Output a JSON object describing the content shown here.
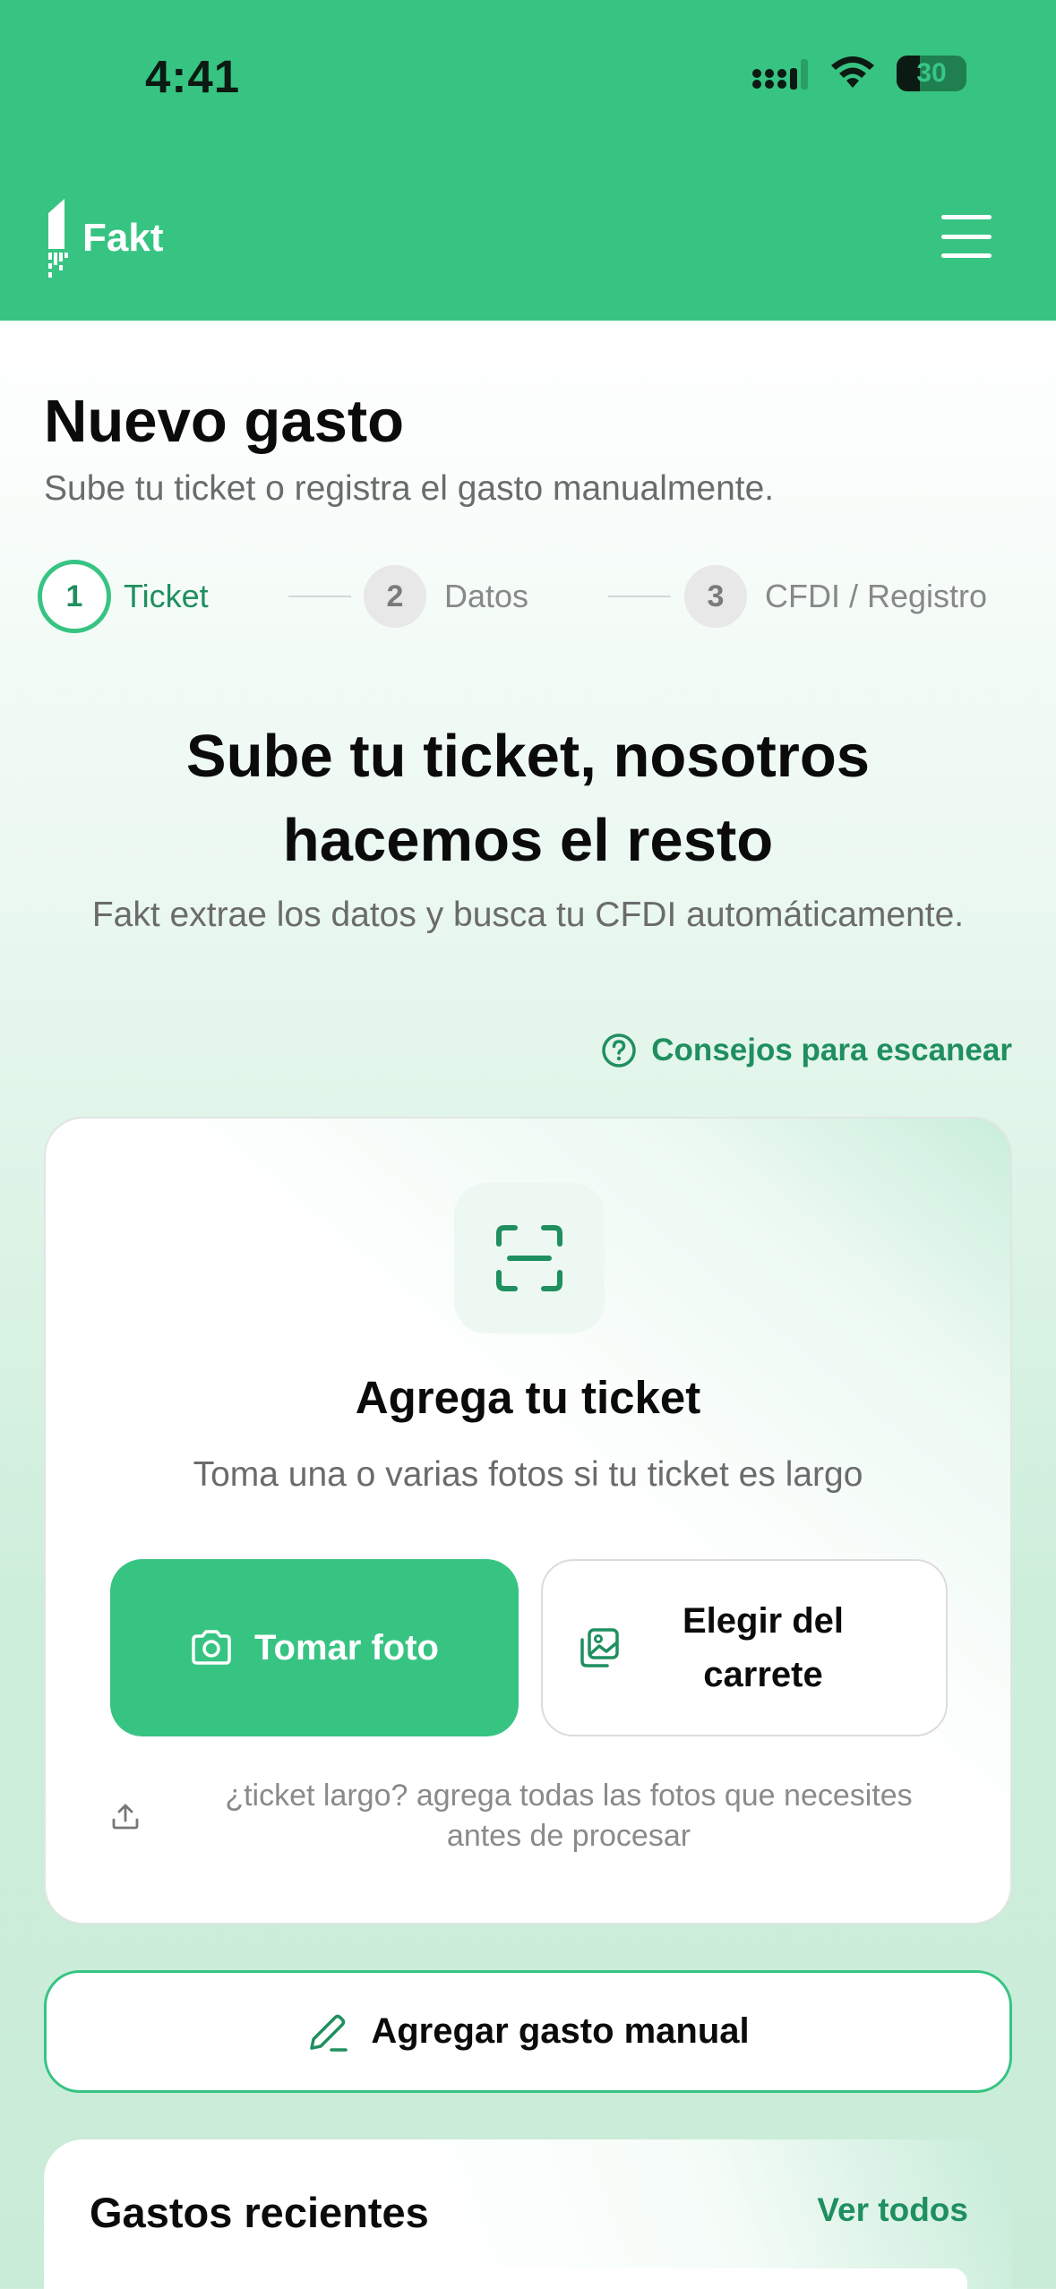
{
  "status_bar": {
    "time": "4:41",
    "battery": "30"
  },
  "header": {
    "brand": "Fakt"
  },
  "page": {
    "title": "Nuevo gasto",
    "subtitle": "Sube tu ticket o registra el gasto manualmente."
  },
  "stepper": {
    "steps": [
      {
        "number": "1",
        "label": "Ticket",
        "active": true
      },
      {
        "number": "2",
        "label": "Datos",
        "active": false
      },
      {
        "number": "3",
        "label": "CFDI / Registro",
        "active": false
      }
    ]
  },
  "hero": {
    "title_line1": "Sube tu ticket, nosotros",
    "title_line2": "hacemos el resto",
    "subtitle": "Fakt extrae los datos y busca tu CFDI automáticamente."
  },
  "tips": {
    "label": "Consejos para escanear"
  },
  "upload": {
    "title": "Agrega tu ticket",
    "subtitle": "Toma una o varias fotos si tu ticket es largo",
    "take_photo": "Tomar foto",
    "choose_roll_line1": "Elegir del",
    "choose_roll_line2": "carrete",
    "hint_line1": "¿ticket largo? agrega todas las fotos que necesites",
    "hint_line2": "antes de procesar"
  },
  "manual": {
    "label": "Agregar gasto manual"
  },
  "recent": {
    "title": "Gastos recientes",
    "see_all": "Ver todos"
  },
  "colors": {
    "brand": "#37c483",
    "brand_dark": "#1f8f5f"
  },
  "icons": [
    "signal-icon",
    "wifi-icon",
    "battery-icon",
    "logo-icon",
    "menu-icon",
    "help-circle-icon",
    "scan-icon",
    "camera-icon",
    "image-icon",
    "upload-icon",
    "pencil-icon"
  ]
}
